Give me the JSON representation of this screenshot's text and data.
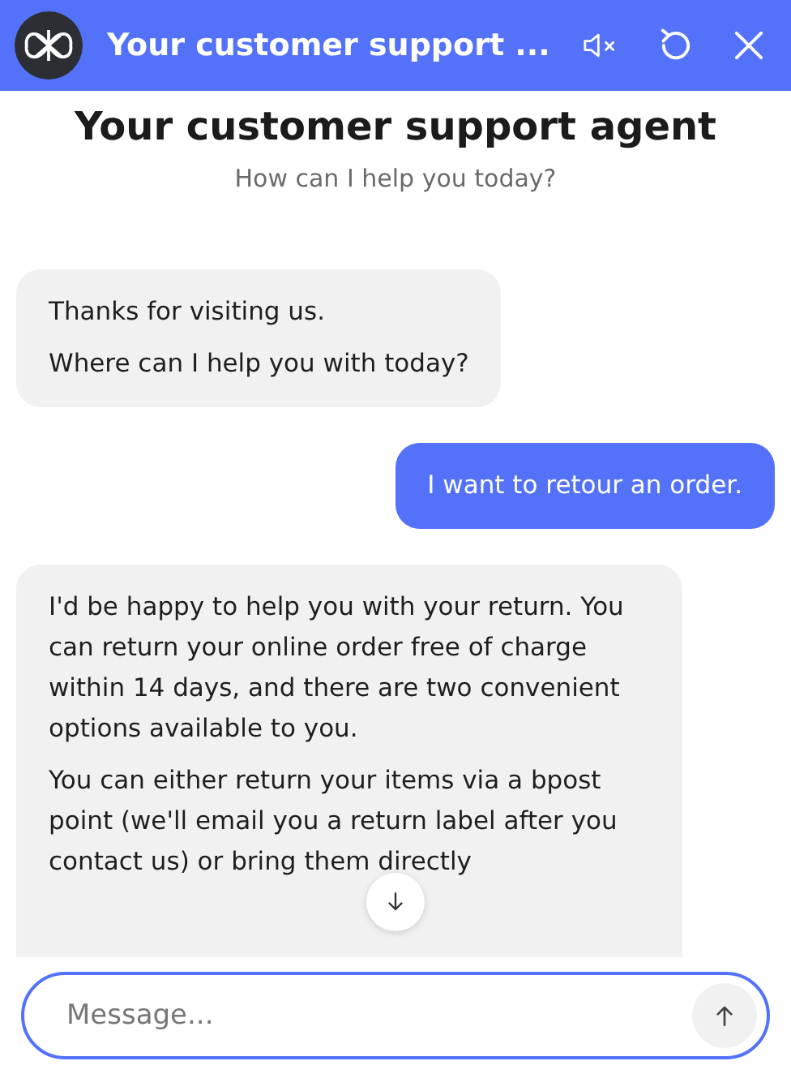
{
  "header": {
    "title": "Your customer support ...",
    "muted": true
  },
  "intro": {
    "title": "Your customer support agent",
    "subtitle": "How can I help you today?"
  },
  "messages": [
    {
      "kind": "bot",
      "paragraphs": [
        "Thanks for visiting us.",
        "Where can I help you with today?"
      ]
    },
    {
      "kind": "user",
      "paragraphs": [
        "I want to retour an order."
      ]
    },
    {
      "kind": "bot",
      "paragraphs": [
        "I'd be happy to help you with your return. You can return your online order free of charge within 14 days, and there are two convenient options available to you.",
        "You can either return your items via a bpost point (we'll email you a return label after you contact us) or bring them directly"
      ]
    }
  ],
  "composer": {
    "placeholder": "Message..."
  }
}
